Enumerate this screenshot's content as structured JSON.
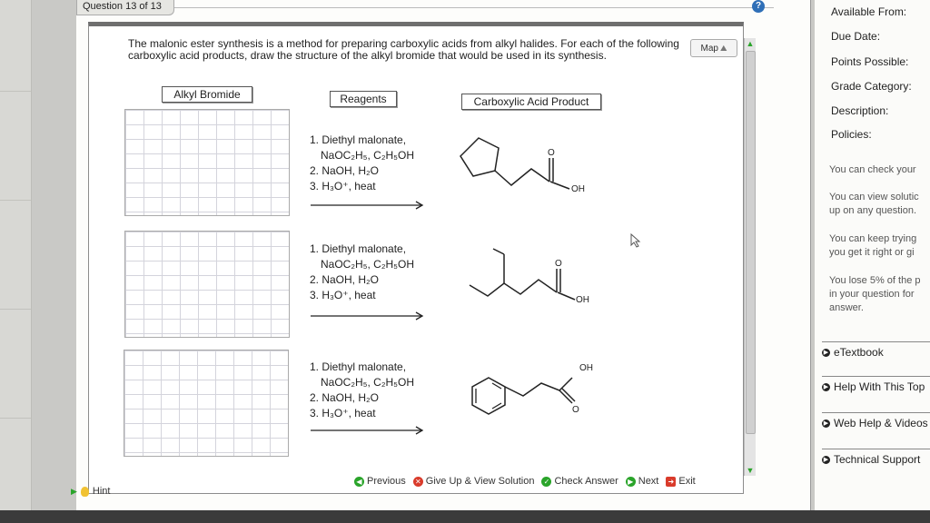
{
  "question": {
    "counter": "Question 13 of 13",
    "help_glyph": "?",
    "intro": "The malonic ester synthesis is a method for preparing carboxylic acids from alkyl halides. For each of the following carboxylic acid products, draw the structure of the alkyl bromide that would be used in its synthesis.",
    "map_label": "Map"
  },
  "columns": {
    "alkyl_bromide": "Alkyl Bromide",
    "reagents": "Reagents",
    "product": "Carboxylic Acid Product"
  },
  "reactions": [
    {
      "step1": "1. Diethyl malonate,",
      "step1b": "NaOC₂H₅, C₂H₅OH",
      "step2": "2. NaOH, H₂O",
      "step3": "3. H₃O⁺, heat",
      "label_o": "O",
      "label_oh": "OH"
    },
    {
      "step1": "1. Diethyl malonate,",
      "step1b": "NaOC₂H₅, C₂H₅OH",
      "step2": "2. NaOH, H₂O",
      "step3": "3. H₃O⁺, heat",
      "label_o": "O",
      "label_oh": "OH"
    },
    {
      "step1": "1. Diethyl malonate,",
      "step1b": "NaOC₂H₅, C₂H₅OH",
      "step2": "2. NaOH, H₂O",
      "step3": "3. H₃O⁺, heat",
      "label_o": "O",
      "label_oh": "OH"
    }
  ],
  "footer": {
    "previous": "Previous",
    "give_up": "Give Up & View Solution",
    "check": "Check Answer",
    "next": "Next",
    "exit": "Exit"
  },
  "hint": "Hint",
  "sidebar": {
    "available_from": "Available From:",
    "due_date": "Due Date:",
    "points_possible": "Points Possible:",
    "grade_category": "Grade Category:",
    "description": "Description:",
    "policies": "Policies:",
    "note1": "You can check your",
    "note2a": "You can view solutic",
    "note2b": "up on any question.",
    "note3a": "You can keep trying",
    "note3b": "you get it right or gi",
    "note4a": "You lose 5% of the p",
    "note4b": "in your question for",
    "note4c": "answer.",
    "etextbook": "eTextbook",
    "help_topic": "Help With This Top",
    "web_help": "Web Help & Videos",
    "tech_support": "Technical Support"
  },
  "colors": {
    "accent_green": "#2aa42a",
    "give_up_red": "#d93b2b",
    "help_blue": "#2f6fb7"
  }
}
